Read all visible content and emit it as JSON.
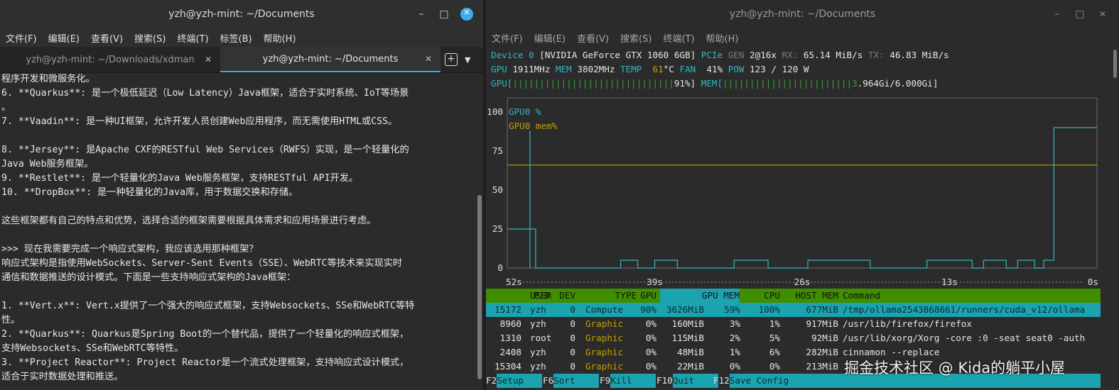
{
  "left_window": {
    "title": "yzh@yzh-mint: ~/Documents",
    "menu": [
      "文件(F)",
      "编辑(E)",
      "查看(V)",
      "搜索(S)",
      "终端(T)",
      "标签(B)",
      "帮助(H)"
    ],
    "tabs": [
      {
        "label": "yzh@yzh-mint: ~/Downloads/xdman",
        "active": false
      },
      {
        "label": "yzh@yzh-mint: ~/Documents",
        "active": true
      }
    ],
    "lines": [
      "程序开发和微服务化。",
      "6. **Quarkus**: 是一个极低延迟（Low Latency）Java框架，适合于实时系统、IoT等场景",
      "。",
      "7. **Vaadin**: 是一种UI框架，允许开发人员创建Web应用程序，而无需使用HTML或CSS。",
      "",
      "8. **Jersey**: 是Apache CXF的RESTful Web Services（RWFS）实现，是一个轻量化的",
      "Java Web服务框架。",
      "9. **Restlet**: 是一个轻量化的Java Web服务框架，支持RESTful API开发。",
      "10. **DropBox**: 是一种轻量化的Java库，用于数据交换和存储。",
      "",
      "这些框架都有自己的特点和优势，选择合适的框架需要根据具体需求和应用场景进行考虑。",
      "",
      ">>> 现在我需要完成一个响应式架构，我应该选用那种框架？",
      "响应式架构是指使用WebSockets、Server-Sent Events（SSE）、WebRTC等技术来实现实时",
      "通信和数据推送的设计模式。下面是一些支持响应式架构的Java框架：",
      "",
      "1. **Vert.x**: Vert.x提供了一个强大的响应式框架，支持Websockets、SSe和WebRTC等特",
      "性。",
      "2. **Quarkus**: Quarkus是Spring Boot的一个替代品，提供了一个轻量化的响应式框架，",
      "支持Websockets、SSe和WebRTC等特性。",
      "3. **Project Reactor**: Project Reactor是一个流式处理框架，支持响应式设计模式，",
      "适合于实时数据处理和推送。"
    ]
  },
  "right_window": {
    "title": "yzh@yzh-mint: ~/Documents",
    "menu": [
      "文件(F)",
      "编辑(E)",
      "查看(V)",
      "搜索(S)",
      "终端(T)",
      "帮助(H)"
    ],
    "device": {
      "label": "Device 0",
      "name": "[NVIDIA GeForce GTX 1060 6GB]",
      "pcie_label": "PCIe",
      "gen_label": "GEN",
      "gen_value": "2@16x",
      "rx_label": "RX:",
      "rx_value": "65.14 MiB/s",
      "tx_label": "TX:",
      "tx_value": "46.83 MiB/s"
    },
    "stats": {
      "gpu_label": "GPU",
      "gpu_clock": "1911MHz",
      "mem_label": "MEM",
      "mem_clock": "3802MHz",
      "temp_label": "TEMP",
      "temp_value": "61",
      "temp_unit": "°C",
      "fan_label": "FAN",
      "fan_value": "41%",
      "pow_label": "POW",
      "pow_value": "123 / 120 W"
    },
    "util_bars": {
      "gpu_label": "GPU[",
      "gpu_bar": "||||||||||||||||||||||||||||||",
      "gpu_value": "91%]",
      "mem_label": "MEM[",
      "mem_bar": "||||||||||||||||||||||||",
      "mem_value_a": "3",
      "mem_value_b": ".964Gi/6.000Gi]"
    },
    "process_header": [
      "PID",
      "USER",
      "DEV",
      "TYPE",
      "GPU",
      "GPU MEM",
      "CPU",
      "HOST MEM",
      "Command"
    ],
    "processes": [
      {
        "pid": "15172",
        "user": "yzh",
        "dev": "0",
        "type": "Compute",
        "gpu": "90%",
        "gpumem": "3626MiB",
        "gpumem_pct": "59%",
        "cpu": "100%",
        "hostmem": "677MiB",
        "cmd": "/tmp/ollama2543868661/runners/cuda_v12/ollama",
        "selected": true
      },
      {
        "pid": "8960",
        "user": "yzh",
        "dev": "0",
        "type": "Graphic",
        "gpu": "0%",
        "gpumem": "160MiB",
        "gpumem_pct": "3%",
        "cpu": "1%",
        "hostmem": "917MiB",
        "cmd": "/usr/lib/firefox/firefox",
        "selected": false
      },
      {
        "pid": "1310",
        "user": "root",
        "dev": "0",
        "type": "Graphic",
        "gpu": "0%",
        "gpumem": "115MiB",
        "gpumem_pct": "2%",
        "cpu": "5%",
        "hostmem": "92MiB",
        "cmd": "/usr/lib/xorg/Xorg -core :0 -seat seat0 -auth",
        "selected": false
      },
      {
        "pid": "2408",
        "user": "yzh",
        "dev": "0",
        "type": "Graphic",
        "gpu": "0%",
        "gpumem": "48MiB",
        "gpumem_pct": "1%",
        "cpu": "6%",
        "hostmem": "282MiB",
        "cmd": "cinnamon --replace",
        "selected": false
      },
      {
        "pid": "15304",
        "user": "yzh",
        "dev": "0",
        "type": "Graphic",
        "gpu": "0%",
        "gpumem": "22MiB",
        "gpumem_pct": "0%",
        "cpu": "0%",
        "hostmem": "213MiB",
        "cmd": "",
        "selected": false
      }
    ],
    "fkeys": [
      {
        "key": "F2",
        "label": "Setup"
      },
      {
        "key": "F6",
        "label": "Sort"
      },
      {
        "key": "F9",
        "label": "Kill"
      },
      {
        "key": "F10",
        "label": "Quit"
      },
      {
        "key": "F12",
        "label": "Save Config"
      }
    ]
  },
  "chart_data": {
    "type": "line",
    "yticks": [
      "100",
      "75",
      "50",
      "25",
      "0"
    ],
    "xticks": [
      "52s",
      "39s",
      "26s",
      "13s",
      "0s"
    ],
    "ylim": [
      0,
      100
    ],
    "xlim": [
      52,
      0
    ],
    "x_units": "seconds ago",
    "legend_placement": "top-left",
    "series": [
      {
        "name": "GPU0 %",
        "color": "#2fb8c0",
        "points": [
          [
            52,
            25
          ],
          [
            49.5,
            25
          ],
          [
            49.5,
            0
          ],
          [
            42,
            0
          ],
          [
            42,
            5
          ],
          [
            40.5,
            5
          ],
          [
            40.5,
            0
          ],
          [
            39,
            0
          ],
          [
            39,
            5
          ],
          [
            37,
            5
          ],
          [
            37,
            0
          ],
          [
            32,
            0
          ],
          [
            32,
            5
          ],
          [
            29,
            5
          ],
          [
            29,
            0
          ],
          [
            25.5,
            0
          ],
          [
            25.5,
            5
          ],
          [
            20,
            5
          ],
          [
            20,
            0
          ],
          [
            15,
            0
          ],
          [
            15,
            5
          ],
          [
            11,
            5
          ],
          [
            11,
            0
          ],
          [
            10,
            0
          ],
          [
            10,
            5
          ],
          [
            8,
            5
          ],
          [
            8,
            0
          ],
          [
            7,
            0
          ],
          [
            7,
            5
          ],
          [
            5.5,
            5
          ],
          [
            5.5,
            0
          ],
          [
            4.7,
            0
          ],
          [
            4.7,
            5
          ],
          [
            3.8,
            5
          ],
          [
            3.8,
            90
          ],
          [
            0,
            90
          ]
        ]
      },
      {
        "name": "GPU0 mem%",
        "color": "#c5a000",
        "points": [
          [
            52,
            66
          ],
          [
            0,
            66
          ]
        ]
      }
    ],
    "spikes": [
      {
        "series": "GPU0 %",
        "x": 50,
        "y": 88
      }
    ]
  },
  "watermark": "掘金技术社区 @ Kida的躺平小屋"
}
